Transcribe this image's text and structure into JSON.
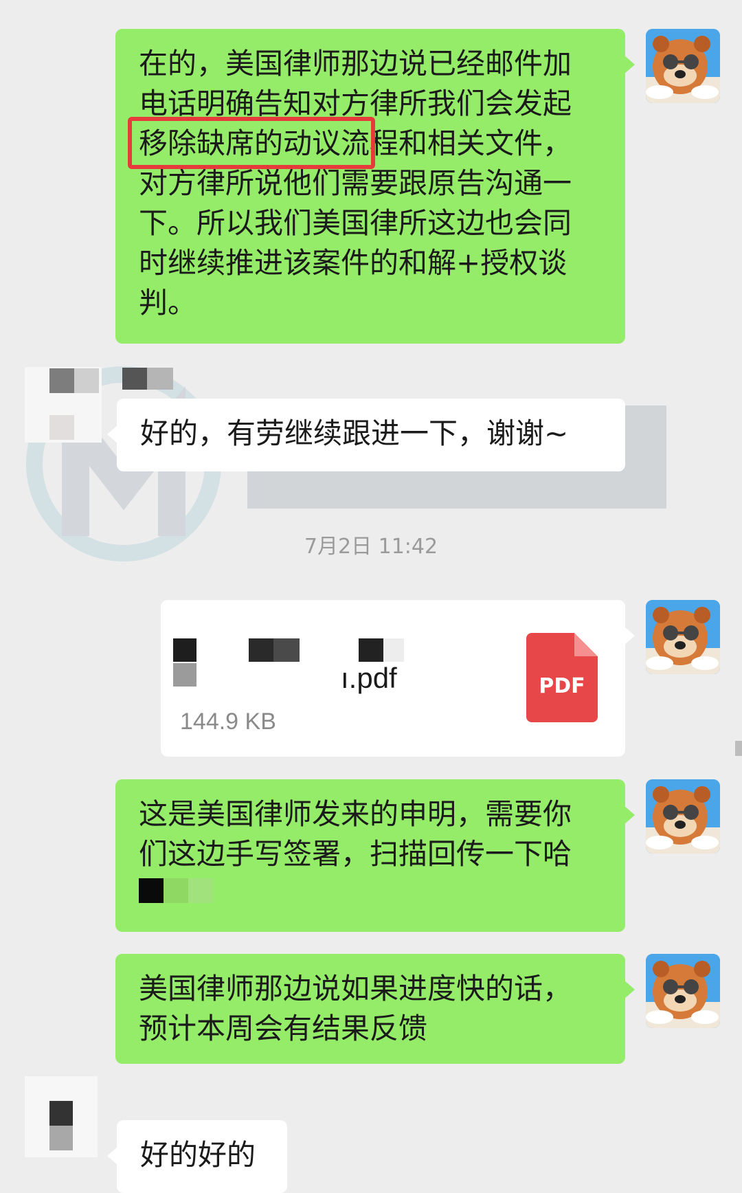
{
  "messages": {
    "m1": {
      "line1": "在的，美国律师那边说已经邮件加",
      "line2": "电话明确告知对方律所我们会发起",
      "line3_highlight": "移除缺席的动议",
      "line3_rest": "流程和相关文件，",
      "line4": "对方律所说他们需要跟原告沟通一",
      "line5": "下。所以我们美国律所这边也会同",
      "line6": "时继续推进该案件的和解+授权谈",
      "line7": "判。"
    },
    "m2": {
      "text": "好的，有劳继续跟进一下，谢谢~"
    },
    "timestamp": "7月2日 11:42",
    "file": {
      "name_suffix": "ı.pdf",
      "size": "144.9 KB",
      "icon_label": "PDF"
    },
    "m3": {
      "line1": "这是美国律师发来的申明，需要你",
      "line2": "们这边手写签署，扫描回传一下哈"
    },
    "m4": {
      "line1": "美国律师那边说如果进度快的话，",
      "line2": "预计本周会有结果反馈"
    },
    "m5": {
      "text": "好的好的"
    }
  },
  "colors": {
    "background": "#ededed",
    "outgoing_bubble": "#95ec69",
    "incoming_bubble": "#ffffff",
    "highlight_box": "#e53b3b",
    "pdf_icon": "#e8474a"
  },
  "icons": {
    "avatar": "cartoon-bear-avatar",
    "file": "pdf-file-icon"
  }
}
